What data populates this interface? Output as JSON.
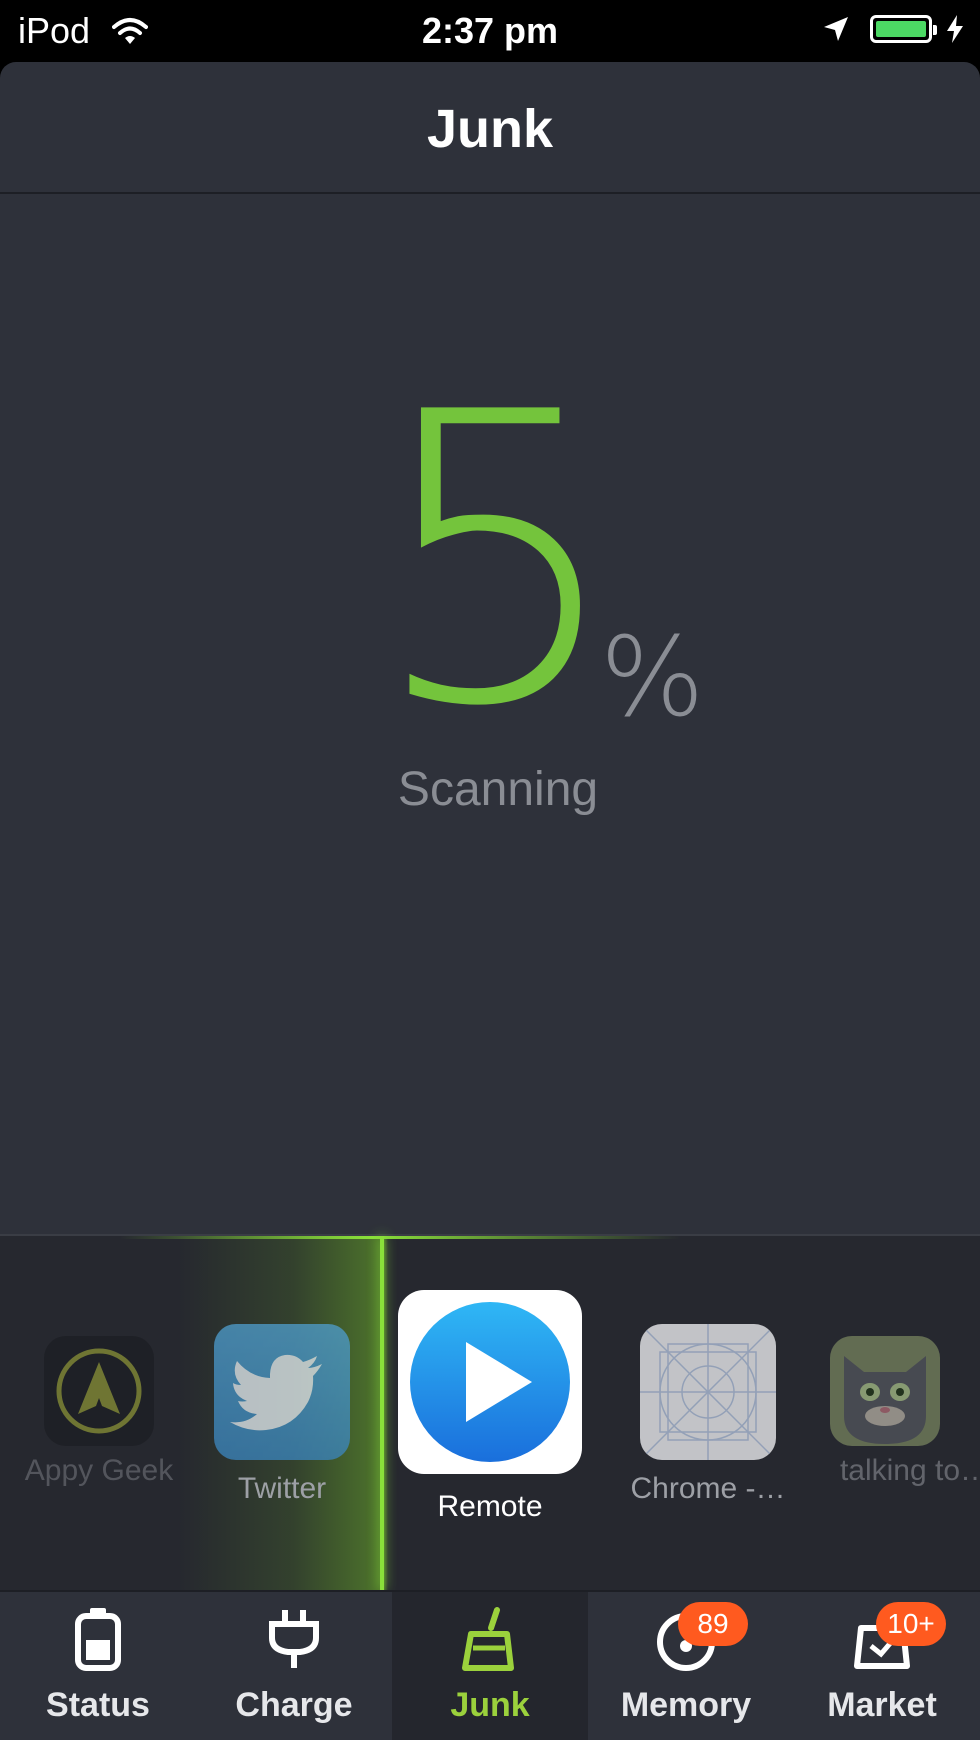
{
  "status_bar": {
    "device": "iPod",
    "time": "2:37 pm",
    "battery_level": 1.0,
    "battery_color": "#4cd964"
  },
  "header": {
    "title": "Junk"
  },
  "scan": {
    "value": "5",
    "unit": "%",
    "status": "Scanning",
    "accent_color": "#74c43c"
  },
  "apps": [
    {
      "name": "Appy Geek",
      "icon": "appy-geek-icon"
    },
    {
      "name": "Twitter",
      "icon": "twitter-icon"
    },
    {
      "name": "Remote",
      "icon": "remote-icon"
    },
    {
      "name": "Chrome -…",
      "icon": "chrome-placeholder-icon"
    },
    {
      "name": "talking to…",
      "icon": "talking-tom-icon"
    }
  ],
  "tabs": [
    {
      "label": "Status",
      "icon": "battery-icon"
    },
    {
      "label": "Charge",
      "icon": "plug-icon"
    },
    {
      "label": "Junk",
      "icon": "broom-icon",
      "active": true
    },
    {
      "label": "Memory",
      "icon": "gauge-icon",
      "badge": "89"
    },
    {
      "label": "Market",
      "icon": "bag-icon",
      "badge": "10+"
    }
  ],
  "colors": {
    "active_tab": "#9bd13c",
    "badge": "#ff5a1f",
    "background": "#2e313a"
  }
}
